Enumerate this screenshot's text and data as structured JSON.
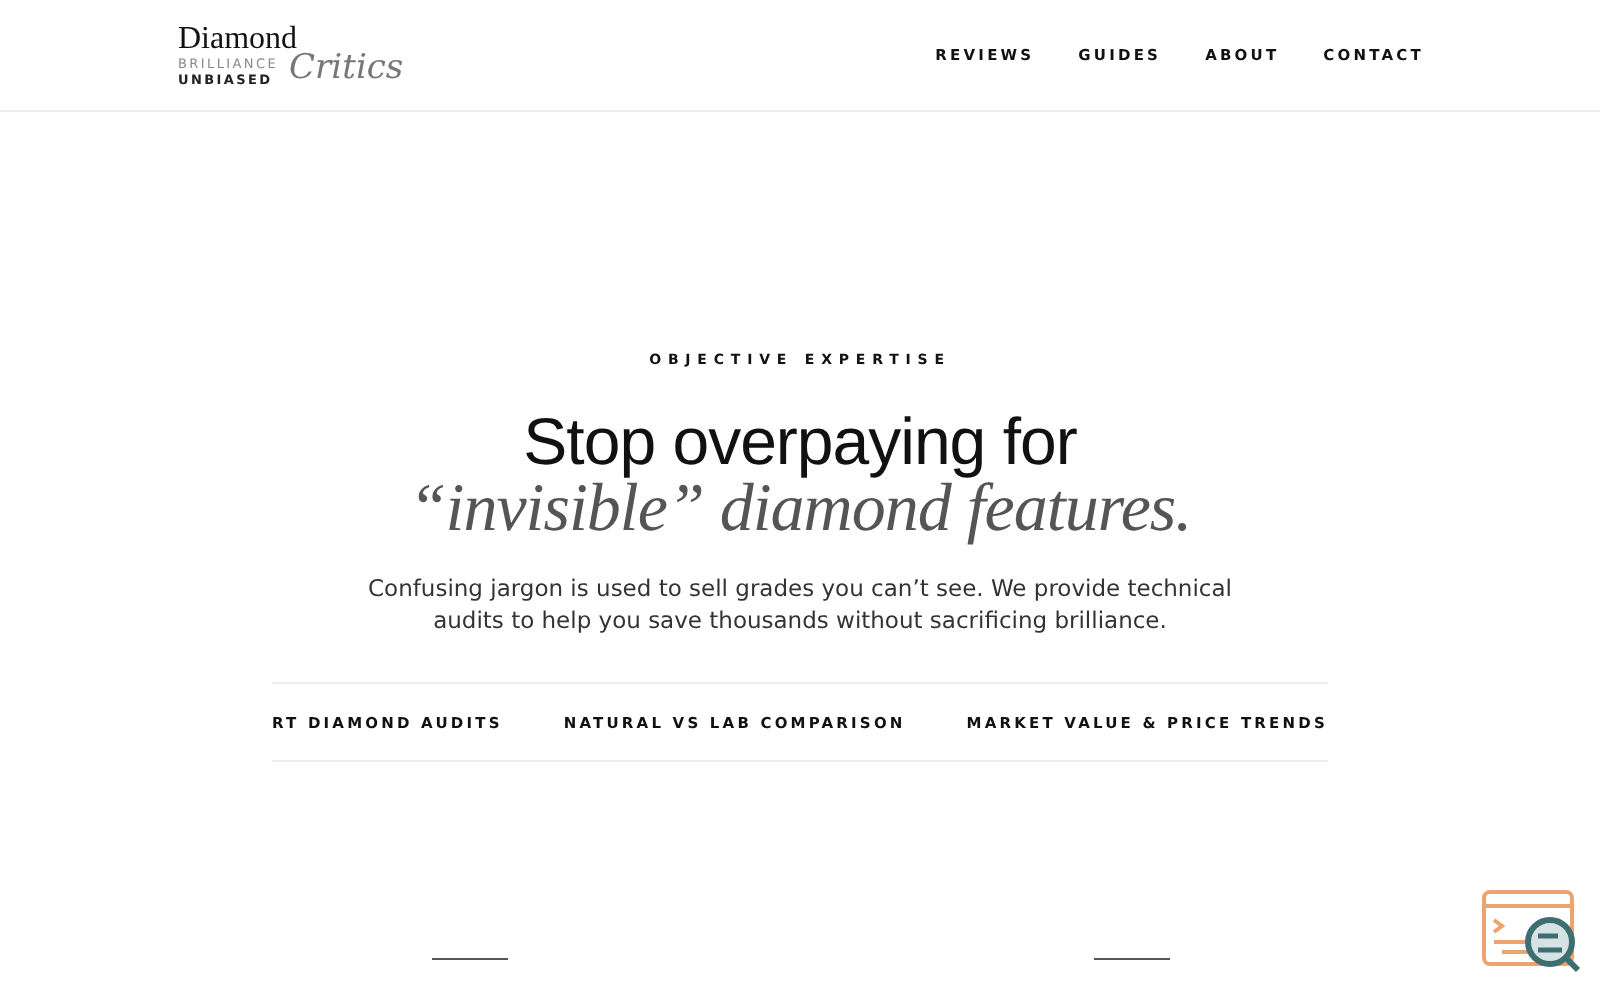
{
  "logo": {
    "word": "Diamond",
    "line_1": "BRILLIANCE",
    "line_2": "UNBIASED",
    "script": "Critics"
  },
  "nav": [
    {
      "label": "REVIEWS"
    },
    {
      "label": "GUIDES"
    },
    {
      "label": "ABOUT"
    },
    {
      "label": "CONTACT"
    }
  ],
  "hero": {
    "eyebrow": "OBJECTIVE EXPERTISE",
    "title": "Stop overpaying for",
    "title_italic": "“invisible” diamond features.",
    "lead": "Confusing jargon is used to sell grades you can’t see. We provide technical audits to help you save thousands without sacrificing brilliance."
  },
  "ticker": [
    "RT DIAMOND AUDITS",
    "NATURAL VS LAB COMPARISON",
    "MARKET VALUE & PRICE TRENDS"
  ]
}
